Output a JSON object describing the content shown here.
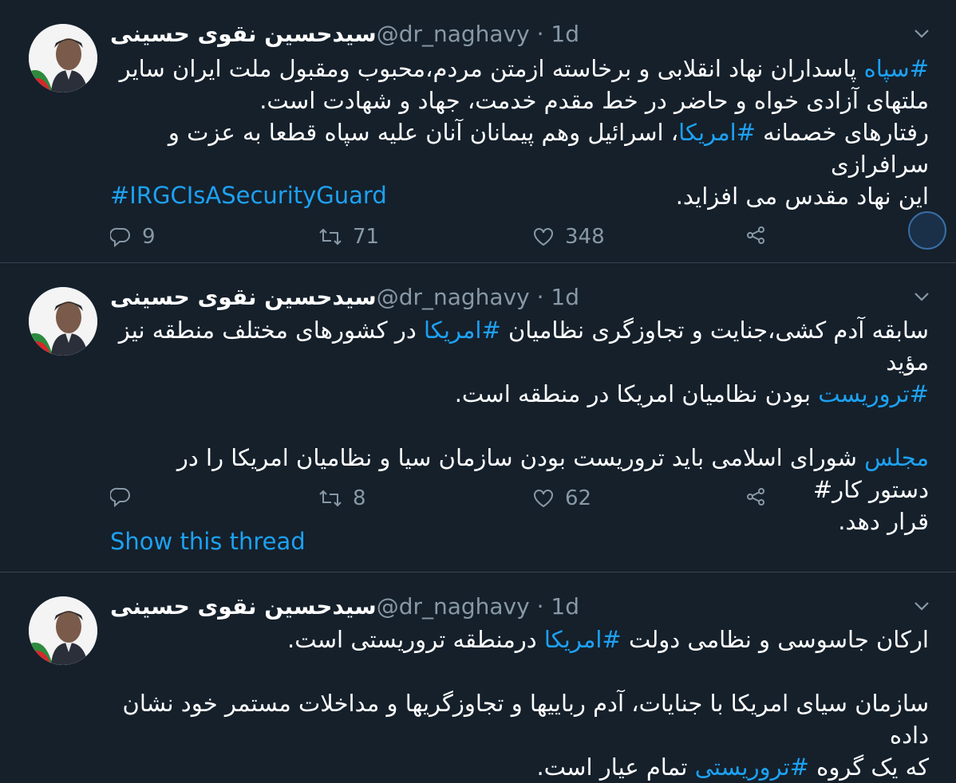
{
  "tweets": [
    {
      "name": "سیدحسین نقوی حسینی",
      "handle": "@dr_naghavy",
      "dot": "·",
      "time": "1d",
      "lines": [
        {
          "pre": "",
          "tag": "#سپاه",
          "post": " پاسداران نهاد انقلابی و برخاسته ازمتن مردم،محبوب ومقبول ملت ایران سایر"
        },
        {
          "pre": "ملتهای آزادی خواه و حاضر در خط مقدم خدمت، جهاد و شهادت است.",
          "tag": "",
          "post": ""
        },
        {
          "pre": "رفتارهای خصمانه ",
          "tag": "#امریکا",
          "post": "، اسرائیل وهم پیمانان آنان علیه سپاه قطعا به عزت و سرافرازی"
        },
        {
          "pre": "این نهاد مقدس می افزاید.",
          "tag": "",
          "post": ""
        }
      ],
      "extra_tag": "#IRGCIsASecurityGuard",
      "replies": "9",
      "retweets": "71",
      "likes": "348"
    },
    {
      "name": "سیدحسین نقوی حسینی",
      "handle": "@dr_naghavy",
      "dot": "·",
      "time": "1d",
      "lines": [
        {
          "pre": "سابقه آدم کشی،جنایت و تجاوزگری نظامیان ",
          "tag": "#امریکا",
          "post": " در کشورهای مختلف منطقه نیز مؤید"
        },
        {
          "pre": "",
          "tag": "#تروریست",
          "post": " بودن نظامیان امریکا در منطقه است."
        },
        {
          "pre": "",
          "tag": "",
          "post": ""
        },
        {
          "pre": "",
          "tag": "مجلس",
          "post": " شورای اسلامی باید تروریست بودن سازمان سیا و نظامیان امریکا را در دستور کار#"
        },
        {
          "pre": "قرار دهد.",
          "tag": "",
          "post": ""
        }
      ],
      "replies": "",
      "retweets": "8",
      "likes": "62",
      "show_thread": "Show this thread"
    },
    {
      "name": "سیدحسین نقوی حسینی",
      "handle": "@dr_naghavy",
      "dot": "·",
      "time": "1d",
      "lines": [
        {
          "pre": "ارکان جاسوسی و نظامی دولت ",
          "tag": "#امریکا",
          "post": " درمنطقه تروریستی است."
        },
        {
          "pre": "",
          "tag": "",
          "post": ""
        },
        {
          "pre": "سازمان سیای امریکا با جنایات، آدم رباییها و تجاوزگریها و مداخلات مستمر خود نشان داده",
          "tag": "",
          "post": ""
        },
        {
          "pre": "که یک گروه ",
          "tag": "#تروریستی",
          "post": " تمام عیار است."
        }
      ]
    }
  ],
  "colors": {
    "bg": "#15202b",
    "accent": "#1da1f2",
    "muted": "#8899a6",
    "divider": "#38444d"
  },
  "icons": {
    "reply": "reply-icon",
    "retweet": "retweet-icon",
    "like": "heart-icon",
    "share": "share-icon",
    "caret": "chevron-down-icon"
  }
}
